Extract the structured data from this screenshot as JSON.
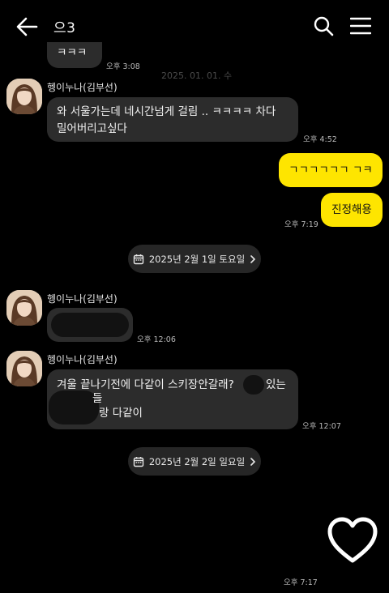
{
  "header": {
    "title": "으3"
  },
  "watermark_date": "2025. 01. 01. 수",
  "messages": {
    "top_partial_text": "ㅋㅋㅋ",
    "top_partial_time": "오후 3:08",
    "sender1_name": "헹이누나(김부선)",
    "msg1_line1": "와 서울가는데 네시간넘게 걸림 .. ㅋㅋㅋㅋ 차다",
    "msg1_line2": "밀어버리고싶다",
    "msg1_time": "오후 4:52",
    "me1_text": "ㄱㄱㄱㄱㄱㄱ ㄱㅋ",
    "me2_text": "진정해용",
    "me_time": "오후 7:19",
    "date1": "2025년 2월 1일 토요일",
    "sender2_name": "헹이누나(김부선)",
    "msg2_time": "오후 12:06",
    "sender3_name": "헹이누나(김부선)",
    "msg3_line1a": "겨울 끝나기전에 다같이 스키장안갈래?",
    "msg3_line1b": "있는",
    "msg3_line2": "들",
    "msg3_line3": "랑 다같이",
    "msg3_time": "오후 12:07",
    "date2": "2025년 2월 2일 일요일",
    "bottom_time": "오후 7:17"
  },
  "icons": {
    "back": "back-arrow-icon",
    "search": "search-icon",
    "menu": "hamburger-menu-icon",
    "calendar": "calendar-icon",
    "chevron": "chevron-right-icon",
    "heart": "heart-icon"
  },
  "colors": {
    "background": "#000000",
    "incoming_bubble": "#2c2c2c",
    "outgoing_bubble": "#fee500",
    "date_pill": "#262626"
  }
}
